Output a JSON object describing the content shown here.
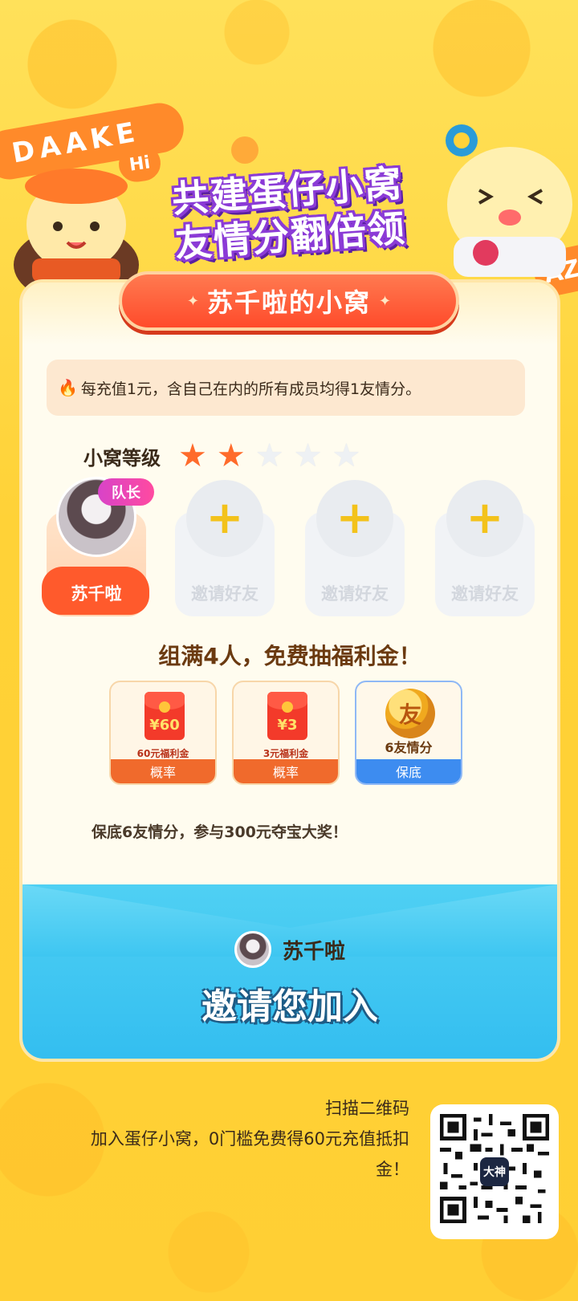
{
  "hero": {
    "ribbon_text": "DAAKE",
    "ribbon_right_text": "AZ",
    "hi_text": "Hi",
    "title_line1": "共建蛋仔小窝",
    "title_line2": "友情分翻倍领"
  },
  "card": {
    "nest_name": "苏千啦的小窝",
    "notice_icon": "fire-icon",
    "notice_text": "每充值1元，含自己在内的所有成员均得1友情分。",
    "level_label": "小窝等级",
    "level_stars_filled": 2,
    "level_stars_total": 5,
    "members": [
      {
        "name": "苏千啦",
        "badge": "队长",
        "is_leader": true
      },
      {
        "name": "邀请好友",
        "is_leader": false
      },
      {
        "name": "邀请好友",
        "is_leader": false
      },
      {
        "name": "邀请好友",
        "is_leader": false
      }
    ],
    "team_title": "组满4人，免费抽福利金！",
    "prizes": [
      {
        "amount": "¥60",
        "caption": "60元福利金",
        "footer": "概率",
        "type": "envelope"
      },
      {
        "amount": "¥3",
        "caption": "3元福利金",
        "footer": "概率",
        "type": "envelope"
      },
      {
        "coin_glyph": "友",
        "caption": "6友情分",
        "footer": "保底",
        "type": "coin"
      }
    ],
    "guarantee_text": "保底6友情分，参与300元夺宝大奖！"
  },
  "invite": {
    "inviter_name": "苏千啦",
    "invite_text": "邀请您加入"
  },
  "footer": {
    "scan_line1": "扫描二维码",
    "scan_line2": "加入蛋仔小窝，0门槛免费得60元充值抵扣",
    "scan_line3": "金！",
    "qr_logo_text": "大神"
  },
  "colors": {
    "background": "#ffd23a",
    "accent_orange": "#ff5a2c",
    "title_purple": "#8b3bd6",
    "invite_blue": "#32bdf0",
    "star_on": "#ff6b2b",
    "star_off": "#eef1f4"
  }
}
